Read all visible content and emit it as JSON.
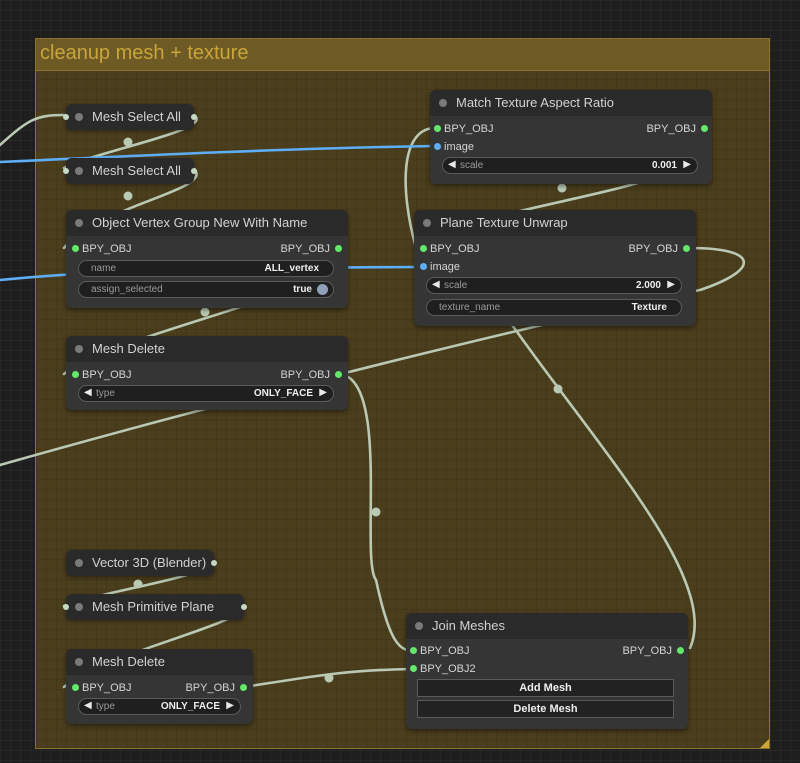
{
  "group": {
    "title": "cleanup mesh + texture",
    "color": "#6e5a25"
  },
  "nodes": {
    "mesh_select_all_1": {
      "title": "Mesh Select All"
    },
    "mesh_select_all_2": {
      "title": "Mesh Select All"
    },
    "object_vertex_group": {
      "title": "Object Vertex Group New With Name",
      "input": "BPY_OBJ",
      "output": "BPY_OBJ",
      "name_label": "name",
      "name_value": "ALL_vertex",
      "assign_label": "assign_selected",
      "assign_value": "true"
    },
    "mesh_delete_1": {
      "title": "Mesh Delete",
      "input": "BPY_OBJ",
      "output": "BPY_OBJ",
      "type_label": "type",
      "type_value": "ONLY_FACE"
    },
    "match_texture": {
      "title": "Match Texture Aspect Ratio",
      "input": "BPY_OBJ",
      "output": "BPY_OBJ",
      "image_label": "image",
      "scale_label": "scale",
      "scale_value": "0.001"
    },
    "plane_unwrap": {
      "title": "Plane Texture Unwrap",
      "input": "BPY_OBJ",
      "output": "BPY_OBJ",
      "image_label": "image",
      "scale_label": "scale",
      "scale_value": "2.000",
      "texture_label": "texture_name",
      "texture_value": "Texture"
    },
    "vector3d": {
      "title": "Vector 3D (Blender)"
    },
    "mesh_primitive_plane": {
      "title": "Mesh Primitive Plane"
    },
    "mesh_delete_2": {
      "title": "Mesh Delete",
      "input": "BPY_OBJ",
      "output": "BPY_OBJ",
      "type_label": "type",
      "type_value": "ONLY_FACE"
    },
    "join_meshes": {
      "title": "Join Meshes",
      "input1": "BPY_OBJ",
      "input2": "BPY_OBJ2",
      "output": "BPY_OBJ",
      "add_label": "Add Mesh",
      "delete_label": "Delete Mesh"
    }
  },
  "colors": {
    "link_object": "#b9c9b4",
    "link_image": "#5eaef5",
    "slot_object": "#64e86a",
    "slot_image": "#5eaef5"
  }
}
